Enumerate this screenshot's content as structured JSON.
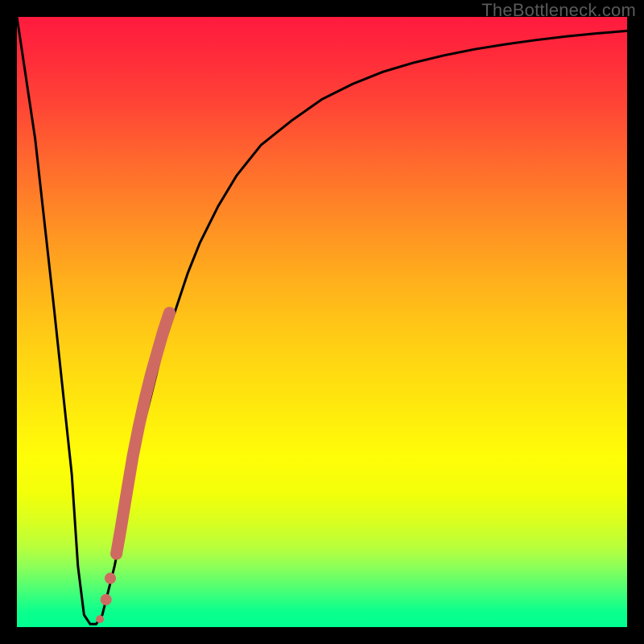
{
  "watermark": "TheBottleneck.com",
  "chart_data": {
    "type": "line",
    "title": "",
    "xlabel": "",
    "ylabel": "",
    "xlim": [
      0,
      100
    ],
    "ylim": [
      0,
      100
    ],
    "series": [
      {
        "name": "bottleneck-curve",
        "x": [
          0,
          3,
          6,
          9,
          10,
          11,
          12,
          13,
          14,
          16,
          18,
          20,
          22,
          24,
          26,
          28,
          30,
          33,
          36,
          40,
          45,
          50,
          55,
          60,
          65,
          70,
          75,
          80,
          85,
          90,
          95,
          100
        ],
        "y": [
          100,
          80,
          53,
          25,
          10,
          2,
          0.5,
          0.5,
          2,
          10,
          20,
          30,
          38,
          46,
          52,
          58,
          63,
          69,
          74,
          79,
          83,
          86.5,
          89,
          91,
          92.5,
          93.7,
          94.7,
          95.5,
          96.2,
          96.8,
          97.3,
          97.7
        ]
      }
    ],
    "highlight_segment": {
      "name": "thick-segment",
      "x": [
        16.3,
        17.0,
        18.0,
        19.0,
        20.0,
        21.0,
        22.0,
        23.0,
        24.0,
        25.0
      ],
      "y": [
        12.0,
        16.0,
        22.0,
        28.0,
        33.0,
        37.5,
        41.5,
        45.0,
        48.5,
        51.5
      ]
    },
    "highlight_points": {
      "name": "dots",
      "x": [
        14.6,
        15.3,
        13.6
      ],
      "y": [
        4.5,
        8.0,
        1.3
      ]
    },
    "colors": {
      "curve": "#000000",
      "highlight": "#cf6a62",
      "background_top": "#ff1a3f",
      "background_bottom": "#00ff90"
    }
  }
}
